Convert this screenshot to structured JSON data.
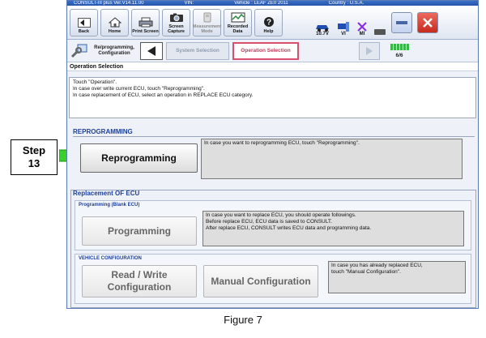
{
  "callout": {
    "step_word": "Step",
    "step_number": "13"
  },
  "title_bar": {
    "app": "CONSULT-III plus   Ver.V14.11.00",
    "vin": "VIN:",
    "vehicle": "Vehicle : LEAF ZE0 2011",
    "country": "Country : U.S.A."
  },
  "toolbar": {
    "back": "Back",
    "home": "Home",
    "print_screen": "Print Screen",
    "screen_capture": "Screen Capture",
    "measurement_mode": "Measurement Mode",
    "recorded_data": "Recorded Data",
    "help": "Help",
    "voltage": "10.7V",
    "vi": "VI",
    "mi": "MI"
  },
  "navbar": {
    "section_label": "Re/programming, Configuration",
    "crumb_system": "System Selection",
    "crumb_operation": "Operation Selection",
    "page_count": "6/6"
  },
  "screen_title": "Operation Selection",
  "instructions": [
    "Touch \"Operation\".",
    "In case over write current ECU, touch \"Reprogramming\".",
    "In case replacement of ECU, select an operation in REPLACE ECU category."
  ],
  "reprogramming": {
    "title": "REPROGRAMMING",
    "button": "Reprogramming",
    "description": "In case you want to reprogramming ECU, touch \"Reprogramming\"."
  },
  "replacement": {
    "title": "Replacement OF ECU",
    "programming_blank": {
      "title": "Programming (Blank ECU)",
      "button": "Programming",
      "description_lines": [
        "In case you want to replace ECU, you should operate followings.",
        "Before replace ECU, ECU data is saved to CONSULT.",
        "After replace ECU, CONSULT writes ECU data and programming data."
      ]
    },
    "vehicle_configuration": {
      "title": "VEHICLE CONFIGURATION",
      "read_write_line1": "Read / Write",
      "read_write_line2": "Configuration",
      "manual_button": "Manual Configuration",
      "description_lines": [
        "In case you has already replaced ECU,",
        "touch \"Manual Configuration\"."
      ]
    }
  },
  "caption": "Figure 7",
  "colors": {
    "accent_blue": "#1c3f99",
    "active_crumb": "#c23a5c",
    "step_arrow": "#39d12c",
    "close_red": "#d63a2c"
  }
}
